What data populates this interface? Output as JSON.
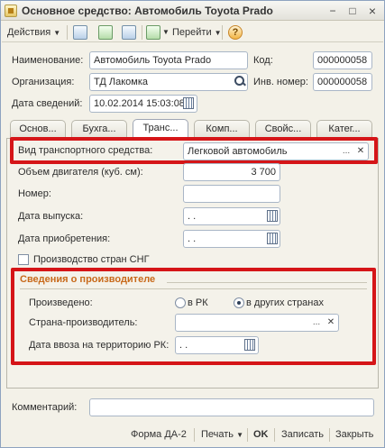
{
  "window": {
    "title": "Основное средство: Автомобиль Toyota Prado",
    "buttons": {
      "minimize": "−",
      "maximize": "□",
      "close": "×"
    }
  },
  "toolbar": {
    "actions_label": "Действия",
    "goto_label": "Перейти",
    "help_label": "?"
  },
  "header": {
    "name_label": "Наименование:",
    "name_value": "Автомобиль Toyota Prado",
    "code_label": "Код:",
    "code_value": "000000058",
    "organization_label": "Организация:",
    "organization_value": "ТД Лакомка",
    "inventory_label": "Инв. номер:",
    "inventory_value": "000000058",
    "date_label": "Дата сведений:",
    "date_value": "10.02.2014 15:03:08"
  },
  "tabs": [
    {
      "label": "Основ..."
    },
    {
      "label": "Бухга..."
    },
    {
      "label": "Транс..."
    },
    {
      "label": "Комп..."
    },
    {
      "label": "Свойс..."
    },
    {
      "label": "Катег..."
    }
  ],
  "transport": {
    "vehicle_type_label": "Вид транспортного средства:",
    "vehicle_type_value": "Легковой автомобиль",
    "engine_label": "Объем двигателя (куб. см):",
    "engine_value": "3 700",
    "number_label": "Номер:",
    "number_value": "",
    "release_date_label": "Дата выпуска:",
    "release_date_value": " .  .",
    "purchase_date_label": "Дата приобретения:",
    "purchase_date_value": " .  .",
    "cis_label": "Производство стран СНГ",
    "cis_checked": false
  },
  "manufacturer": {
    "title": "Сведения о производителе",
    "produced_label": "Произведено:",
    "option_rk": "в РК",
    "option_other": "в других странах",
    "selected": "other",
    "country_label": "Страна-производитель:",
    "country_value": "",
    "import_date_label": "Дата ввоза на территорию РК:",
    "import_date_value": " .  ."
  },
  "comment": {
    "label": "Комментарий:",
    "value": ""
  },
  "footer": {
    "form_label": "Форма ДА-2",
    "print_label": "Печать",
    "ok_label": "OK",
    "save_label": "Записать",
    "close_label": "Закрыть"
  },
  "colors": {
    "highlight": "#d51518",
    "group_title": "#c8691a"
  }
}
